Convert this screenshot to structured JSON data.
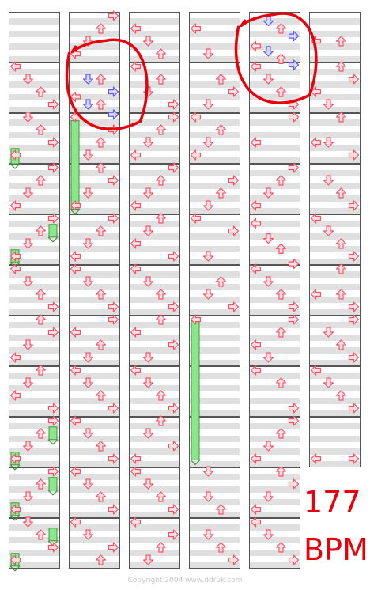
{
  "bpm": {
    "value": "177",
    "unit": "BPM"
  },
  "copyright": "Copyright 2004 www.ddruk.com",
  "colors": {
    "note": "#ff5064",
    "note_alt": "#5a5aff",
    "freeze": "#8ce68c",
    "annotation": "#e8000a"
  },
  "chart_layout": {
    "columns": 6,
    "lanes": [
      "left",
      "down",
      "up",
      "right"
    ],
    "measures_per_column": [
      11,
      11,
      11,
      11,
      11,
      9
    ]
  },
  "notes": [
    {
      "c": 0,
      "m": 1,
      "l": 0,
      "b": 0
    },
    {
      "c": 0,
      "m": 1,
      "l": 1,
      "b": 0.25
    },
    {
      "c": 0,
      "m": 1,
      "l": 2,
      "b": 0.5
    },
    {
      "c": 0,
      "m": 1,
      "l": 3,
      "b": 0.75
    },
    {
      "c": 0,
      "m": 2,
      "l": 1,
      "b": 0
    },
    {
      "c": 0,
      "m": 2,
      "l": 2,
      "b": 0.25
    },
    {
      "c": 0,
      "m": 2,
      "l": 3,
      "b": 0.5
    },
    {
      "c": 0,
      "m": 2,
      "l": 0,
      "b": 0.75
    },
    {
      "c": 0,
      "m": 3,
      "l": 3,
      "b": 0
    },
    {
      "c": 0,
      "m": 3,
      "l": 2,
      "b": 0.25
    },
    {
      "c": 0,
      "m": 3,
      "l": 1,
      "b": 0.5
    },
    {
      "c": 0,
      "m": 3,
      "l": 0,
      "b": 0.75
    },
    {
      "c": 0,
      "m": 4,
      "l": 3,
      "b": 0
    },
    {
      "c": 0,
      "m": 4,
      "l": 2,
      "b": 0.25
    },
    {
      "c": 0,
      "m": 4,
      "l": 1,
      "b": 0.5
    },
    {
      "c": 0,
      "m": 4,
      "l": 0,
      "b": 0.75
    },
    {
      "c": 0,
      "m": 5,
      "l": 0,
      "b": 0
    },
    {
      "c": 0,
      "m": 5,
      "l": 1,
      "b": 0.25
    },
    {
      "c": 0,
      "m": 5,
      "l": 2,
      "b": 0.5
    },
    {
      "c": 0,
      "m": 5,
      "l": 3,
      "b": 0.75
    },
    {
      "c": 0,
      "m": 6,
      "l": 2,
      "b": 0
    },
    {
      "c": 0,
      "m": 6,
      "l": 3,
      "b": 0.25
    },
    {
      "c": 0,
      "m": 6,
      "l": 1,
      "b": 0.5
    },
    {
      "c": 0,
      "m": 6,
      "l": 0,
      "b": 0.75
    },
    {
      "c": 0,
      "m": 7,
      "l": 2,
      "b": 0
    },
    {
      "c": 0,
      "m": 7,
      "l": 1,
      "b": 0.25
    },
    {
      "c": 0,
      "m": 7,
      "l": 0,
      "b": 0.5
    },
    {
      "c": 0,
      "m": 7,
      "l": 3,
      "b": 0.75
    },
    {
      "c": 0,
      "m": 8,
      "l": 3,
      "b": 0
    },
    {
      "c": 0,
      "m": 8,
      "l": 2,
      "b": 0.25
    },
    {
      "c": 0,
      "m": 8,
      "l": 1,
      "b": 0.5
    },
    {
      "c": 0,
      "m": 8,
      "l": 0,
      "b": 0.75
    },
    {
      "c": 0,
      "m": 9,
      "l": 3,
      "b": 0
    },
    {
      "c": 0,
      "m": 9,
      "l": 2,
      "b": 0.25
    },
    {
      "c": 0,
      "m": 9,
      "l": 1,
      "b": 0.5
    },
    {
      "c": 0,
      "m": 9,
      "l": 0,
      "b": 0.75
    },
    {
      "c": 0,
      "m": 10,
      "l": 1,
      "b": 0
    },
    {
      "c": 0,
      "m": 10,
      "l": 2,
      "b": 0.25
    },
    {
      "c": 0,
      "m": 10,
      "l": 3,
      "b": 0.5
    },
    {
      "c": 0,
      "m": 10,
      "l": 0,
      "b": 0.75
    },
    {
      "c": 1,
      "m": 0,
      "l": 3,
      "b": 0
    },
    {
      "c": 1,
      "m": 0,
      "l": 2,
      "b": 0.25
    },
    {
      "c": 1,
      "m": 0,
      "l": 1,
      "b": 0.5
    },
    {
      "c": 1,
      "m": 0,
      "l": 0,
      "b": 0.75
    },
    {
      "c": 1,
      "m": 1,
      "l": 1,
      "b": 0.25
    },
    {
      "c": 1,
      "m": 1,
      "l": 2,
      "b": 0.25
    },
    {
      "c": 1,
      "m": 1,
      "l": 3,
      "b": 0.5
    },
    {
      "c": 1,
      "m": 1,
      "l": 0,
      "b": 0.6
    },
    {
      "c": 1,
      "m": 1,
      "l": 1,
      "b": 0.75
    },
    {
      "c": 1,
      "m": 1,
      "l": 2,
      "b": 0.75
    },
    {
      "c": 1,
      "m": 1,
      "l": 3,
      "b": 0.95
    },
    {
      "c": 1,
      "m": 2,
      "l": 0,
      "b": 0
    },
    {
      "c": 1,
      "m": 2,
      "l": 3,
      "b": 0.25
    },
    {
      "c": 1,
      "m": 2,
      "l": 2,
      "b": 0.5
    },
    {
      "c": 1,
      "m": 2,
      "l": 1,
      "b": 0.75
    },
    {
      "c": 1,
      "m": 3,
      "l": 2,
      "b": 0
    },
    {
      "c": 1,
      "m": 3,
      "l": 3,
      "b": 0.25
    },
    {
      "c": 1,
      "m": 3,
      "l": 1,
      "b": 0.5
    },
    {
      "c": 1,
      "m": 3,
      "l": 0,
      "b": 0.75
    },
    {
      "c": 1,
      "m": 4,
      "l": 3,
      "b": 0
    },
    {
      "c": 1,
      "m": 4,
      "l": 2,
      "b": 0.25
    },
    {
      "c": 1,
      "m": 4,
      "l": 1,
      "b": 0.5
    },
    {
      "c": 1,
      "m": 4,
      "l": 0,
      "b": 0.75
    },
    {
      "c": 1,
      "m": 5,
      "l": 0,
      "b": 0
    },
    {
      "c": 1,
      "m": 5,
      "l": 1,
      "b": 0.25
    },
    {
      "c": 1,
      "m": 5,
      "l": 2,
      "b": 0.5
    },
    {
      "c": 1,
      "m": 5,
      "l": 3,
      "b": 0.75
    },
    {
      "c": 1,
      "m": 6,
      "l": 3,
      "b": 0
    },
    {
      "c": 1,
      "m": 6,
      "l": 0,
      "b": 0.25
    },
    {
      "c": 1,
      "m": 6,
      "l": 2,
      "b": 0.5
    },
    {
      "c": 1,
      "m": 6,
      "l": 1,
      "b": 0.75
    },
    {
      "c": 1,
      "m": 7,
      "l": 0,
      "b": 0
    },
    {
      "c": 1,
      "m": 7,
      "l": 1,
      "b": 0.25
    },
    {
      "c": 1,
      "m": 7,
      "l": 2,
      "b": 0.5
    },
    {
      "c": 1,
      "m": 7,
      "l": 3,
      "b": 0.75
    },
    {
      "c": 1,
      "m": 8,
      "l": 0,
      "b": 0
    },
    {
      "c": 1,
      "m": 8,
      "l": 1,
      "b": 0.25
    },
    {
      "c": 1,
      "m": 8,
      "l": 2,
      "b": 0.5
    },
    {
      "c": 1,
      "m": 8,
      "l": 3,
      "b": 0.75
    },
    {
      "c": 1,
      "m": 9,
      "l": 0,
      "b": 0
    },
    {
      "c": 1,
      "m": 9,
      "l": 1,
      "b": 0.25
    },
    {
      "c": 1,
      "m": 9,
      "l": 2,
      "b": 0.5
    },
    {
      "c": 1,
      "m": 9,
      "l": 3,
      "b": 0.75
    },
    {
      "c": 1,
      "m": 10,
      "l": 0,
      "b": 0
    },
    {
      "c": 1,
      "m": 10,
      "l": 1,
      "b": 0.25
    },
    {
      "c": 1,
      "m": 10,
      "l": 3,
      "b": 0.5
    },
    {
      "c": 1,
      "m": 10,
      "l": 2,
      "b": 0.75
    },
    {
      "c": 2,
      "m": 0,
      "l": 0,
      "b": 0.25
    },
    {
      "c": 2,
      "m": 0,
      "l": 1,
      "b": 0.5
    },
    {
      "c": 2,
      "m": 0,
      "l": 2,
      "b": 0.75
    },
    {
      "c": 2,
      "m": 1,
      "l": 0,
      "b": 0
    },
    {
      "c": 2,
      "m": 1,
      "l": 2,
      "b": 0.25
    },
    {
      "c": 2,
      "m": 1,
      "l": 1,
      "b": 0.5
    },
    {
      "c": 2,
      "m": 1,
      "l": 3,
      "b": 0.75
    },
    {
      "c": 2,
      "m": 2,
      "l": 3,
      "b": 0
    },
    {
      "c": 2,
      "m": 2,
      "l": 2,
      "b": 0.25
    },
    {
      "c": 2,
      "m": 2,
      "l": 1,
      "b": 0.5
    },
    {
      "c": 2,
      "m": 2,
      "l": 0,
      "b": 0.75
    },
    {
      "c": 2,
      "m": 3,
      "l": 3,
      "b": 0
    },
    {
      "c": 2,
      "m": 3,
      "l": 2,
      "b": 0.25
    },
    {
      "c": 2,
      "m": 3,
      "l": 1,
      "b": 0.5
    },
    {
      "c": 2,
      "m": 3,
      "l": 0,
      "b": 0.75
    },
    {
      "c": 2,
      "m": 4,
      "l": 2,
      "b": 0
    },
    {
      "c": 2,
      "m": 4,
      "l": 1,
      "b": 0.25
    },
    {
      "c": 2,
      "m": 4,
      "l": 0,
      "b": 0.5
    },
    {
      "c": 2,
      "m": 4,
      "l": 3,
      "b": 0.75
    },
    {
      "c": 2,
      "m": 5,
      "l": 0,
      "b": 0
    },
    {
      "c": 2,
      "m": 5,
      "l": 1,
      "b": 0.25
    },
    {
      "c": 2,
      "m": 5,
      "l": 2,
      "b": 0.5
    },
    {
      "c": 2,
      "m": 5,
      "l": 3,
      "b": 0.75
    },
    {
      "c": 2,
      "m": 6,
      "l": 2,
      "b": 0
    },
    {
      "c": 2,
      "m": 6,
      "l": 0,
      "b": 0.25
    },
    {
      "c": 2,
      "m": 6,
      "l": 3,
      "b": 0.5
    },
    {
      "c": 2,
      "m": 6,
      "l": 1,
      "b": 0.75
    },
    {
      "c": 2,
      "m": 7,
      "l": 0,
      "b": 0
    },
    {
      "c": 2,
      "m": 7,
      "l": 1,
      "b": 0.25
    },
    {
      "c": 2,
      "m": 7,
      "l": 2,
      "b": 0.5
    },
    {
      "c": 2,
      "m": 7,
      "l": 3,
      "b": 0.75
    },
    {
      "c": 2,
      "m": 8,
      "l": 2,
      "b": 0
    },
    {
      "c": 2,
      "m": 8,
      "l": 1,
      "b": 0.25
    },
    {
      "c": 2,
      "m": 8,
      "l": 3,
      "b": 0.5
    },
    {
      "c": 2,
      "m": 8,
      "l": 0,
      "b": 0.75
    },
    {
      "c": 2,
      "m": 9,
      "l": 0,
      "b": 0
    },
    {
      "c": 2,
      "m": 9,
      "l": 1,
      "b": 0.25
    },
    {
      "c": 2,
      "m": 9,
      "l": 2,
      "b": 0.5
    },
    {
      "c": 2,
      "m": 9,
      "l": 3,
      "b": 0.75
    },
    {
      "c": 2,
      "m": 10,
      "l": 0,
      "b": 0
    },
    {
      "c": 2,
      "m": 10,
      "l": 3,
      "b": 0.25
    },
    {
      "c": 2,
      "m": 10,
      "l": 2,
      "b": 0.5
    },
    {
      "c": 2,
      "m": 10,
      "l": 1,
      "b": 0.75
    },
    {
      "c": 3,
      "m": 0,
      "l": 0,
      "b": 0.25
    },
    {
      "c": 3,
      "m": 0,
      "l": 1,
      "b": 0.75
    },
    {
      "c": 3,
      "m": 1,
      "l": 2,
      "b": 0.25
    },
    {
      "c": 3,
      "m": 1,
      "l": 3,
      "b": 0.5
    },
    {
      "c": 3,
      "m": 1,
      "l": 1,
      "b": 0.75
    },
    {
      "c": 3,
      "m": 2,
      "l": 0,
      "b": 0
    },
    {
      "c": 3,
      "m": 2,
      "l": 2,
      "b": 0.25
    },
    {
      "c": 3,
      "m": 2,
      "l": 1,
      "b": 0.5
    },
    {
      "c": 3,
      "m": 2,
      "l": 0,
      "b": 0.75
    },
    {
      "c": 3,
      "m": 3,
      "l": 3,
      "b": 0.25
    },
    {
      "c": 3,
      "m": 3,
      "l": 2,
      "b": 0.5
    },
    {
      "c": 3,
      "m": 3,
      "l": 1,
      "b": 0.75
    },
    {
      "c": 3,
      "m": 4,
      "l": 0,
      "b": 0
    },
    {
      "c": 3,
      "m": 4,
      "l": 3,
      "b": 0.25
    },
    {
      "c": 3,
      "m": 4,
      "l": 1,
      "b": 0.75
    },
    {
      "c": 3,
      "m": 5,
      "l": 2,
      "b": 0.25
    },
    {
      "c": 3,
      "m": 5,
      "l": 1,
      "b": 0.5
    },
    {
      "c": 3,
      "m": 5,
      "l": 3,
      "b": 0.75
    },
    {
      "c": 3,
      "m": 6,
      "l": 0,
      "b": 0
    },
    {
      "c": 3,
      "m": 9,
      "l": 1,
      "b": 0
    },
    {
      "c": 3,
      "m": 9,
      "l": 1,
      "b": 0.5
    },
    {
      "c": 3,
      "m": 9,
      "l": 2,
      "b": 0.75
    },
    {
      "c": 3,
      "m": 10,
      "l": 1,
      "b": 0.25
    },
    {
      "c": 3,
      "m": 10,
      "l": 2,
      "b": 0.5
    },
    {
      "c": 3,
      "m": 10,
      "l": 3,
      "b": 0.75
    },
    {
      "c": 4,
      "m": 0,
      "l": 1,
      "b": 0.1
    },
    {
      "c": 4,
      "m": 0,
      "l": 2,
      "b": 0.25
    },
    {
      "c": 4,
      "m": 0,
      "l": 3,
      "b": 0.4
    },
    {
      "c": 4,
      "m": 0,
      "l": 0,
      "b": 0.6
    },
    {
      "c": 4,
      "m": 0,
      "l": 1,
      "b": 0.7
    },
    {
      "c": 4,
      "m": 0,
      "l": 2,
      "b": 0.85
    },
    {
      "c": 4,
      "m": 0,
      "l": 3,
      "b": 0.97
    },
    {
      "c": 4,
      "m": 1,
      "l": 0,
      "b": 0
    },
    {
      "c": 4,
      "m": 1,
      "l": 1,
      "b": 0.25
    },
    {
      "c": 4,
      "m": 1,
      "l": 2,
      "b": 0.5
    },
    {
      "c": 4,
      "m": 1,
      "l": 3,
      "b": 0.75
    },
    {
      "c": 4,
      "m": 2,
      "l": 3,
      "b": 0
    },
    {
      "c": 4,
      "m": 2,
      "l": 0,
      "b": 0.5
    },
    {
      "c": 4,
      "m": 3,
      "l": 3,
      "b": 0
    },
    {
      "c": 4,
      "m": 3,
      "l": 2,
      "b": 0.25
    },
    {
      "c": 4,
      "m": 3,
      "l": 1,
      "b": 0.5
    },
    {
      "c": 4,
      "m": 3,
      "l": 0,
      "b": 0.75
    },
    {
      "c": 4,
      "m": 4,
      "l": 0,
      "b": 0.1
    },
    {
      "c": 4,
      "m": 4,
      "l": 1,
      "b": 0.4
    },
    {
      "c": 4,
      "m": 4,
      "l": 2,
      "b": 0.6
    },
    {
      "c": 4,
      "m": 4,
      "l": 3,
      "b": 0.9
    },
    {
      "c": 4,
      "m": 5,
      "l": 0,
      "b": 0
    },
    {
      "c": 4,
      "m": 5,
      "l": 1,
      "b": 0.25
    },
    {
      "c": 4,
      "m": 5,
      "l": 2,
      "b": 0.5
    },
    {
      "c": 4,
      "m": 5,
      "l": 3,
      "b": 0.75
    },
    {
      "c": 4,
      "m": 6,
      "l": 3,
      "b": 0
    },
    {
      "c": 4,
      "m": 6,
      "l": 2,
      "b": 0.25
    },
    {
      "c": 4,
      "m": 6,
      "l": 0,
      "b": 0.5
    },
    {
      "c": 4,
      "m": 6,
      "l": 1,
      "b": 0.75
    },
    {
      "c": 4,
      "m": 7,
      "l": 0,
      "b": 0
    },
    {
      "c": 4,
      "m": 7,
      "l": 2,
      "b": 0.25
    },
    {
      "c": 4,
      "m": 7,
      "l": 3,
      "b": 0.75
    },
    {
      "c": 4,
      "m": 8,
      "l": 3,
      "b": 0
    },
    {
      "c": 4,
      "m": 8,
      "l": 2,
      "b": 0.25
    },
    {
      "c": 4,
      "m": 8,
      "l": 1,
      "b": 0.5
    },
    {
      "c": 4,
      "m": 8,
      "l": 0,
      "b": 0.75
    },
    {
      "c": 4,
      "m": 9,
      "l": 2,
      "b": 0
    },
    {
      "c": 4,
      "m": 9,
      "l": 3,
      "b": 0.25
    },
    {
      "c": 4,
      "m": 9,
      "l": 1,
      "b": 0.5
    },
    {
      "c": 4,
      "m": 9,
      "l": 0,
      "b": 0.75
    },
    {
      "c": 4,
      "m": 10,
      "l": 0,
      "b": 0
    },
    {
      "c": 4,
      "m": 10,
      "l": 1,
      "b": 0.25
    },
    {
      "c": 4,
      "m": 10,
      "l": 2,
      "b": 0.5
    },
    {
      "c": 4,
      "m": 10,
      "l": 3,
      "b": 0.75
    },
    {
      "c": 5,
      "m": 0,
      "l": 0,
      "b": 0.5
    },
    {
      "c": 5,
      "m": 0,
      "l": 2,
      "b": 0.5
    },
    {
      "c": 5,
      "m": 1,
      "l": 2,
      "b": 0
    },
    {
      "c": 5,
      "m": 1,
      "l": 3,
      "b": 0.25
    },
    {
      "c": 5,
      "m": 1,
      "l": 0,
      "b": 0.5
    },
    {
      "c": 5,
      "m": 1,
      "l": 1,
      "b": 0.75
    },
    {
      "c": 5,
      "m": 2,
      "l": 2,
      "b": 0
    },
    {
      "c": 5,
      "m": 2,
      "l": 0,
      "b": 0.5
    },
    {
      "c": 5,
      "m": 2,
      "l": 1,
      "b": 0.5
    },
    {
      "c": 5,
      "m": 2,
      "l": 3,
      "b": 0.75
    },
    {
      "c": 5,
      "m": 3,
      "l": 1,
      "b": 0.25
    },
    {
      "c": 5,
      "m": 3,
      "l": 2,
      "b": 0.5
    },
    {
      "c": 5,
      "m": 3,
      "l": 3,
      "b": 0.75
    },
    {
      "c": 5,
      "m": 4,
      "l": 0,
      "b": 0
    },
    {
      "c": 5,
      "m": 4,
      "l": 1,
      "b": 0.25
    },
    {
      "c": 5,
      "m": 4,
      "l": 2,
      "b": 0.5
    },
    {
      "c": 5,
      "m": 4,
      "l": 3,
      "b": 0.75
    },
    {
      "c": 5,
      "m": 5,
      "l": 2,
      "b": 0
    },
    {
      "c": 5,
      "m": 5,
      "l": 0,
      "b": 0.5
    },
    {
      "c": 5,
      "m": 5,
      "l": 2,
      "b": 0.5
    },
    {
      "c": 5,
      "m": 5,
      "l": 3,
      "b": 0.75
    },
    {
      "c": 5,
      "m": 6,
      "l": 3,
      "b": 0
    },
    {
      "c": 5,
      "m": 6,
      "l": 1,
      "b": 0.25
    },
    {
      "c": 5,
      "m": 6,
      "l": 2,
      "b": 0.5
    },
    {
      "c": 5,
      "m": 6,
      "l": 3,
      "b": 0.75
    },
    {
      "c": 5,
      "m": 7,
      "l": 0,
      "b": 0
    },
    {
      "c": 5,
      "m": 7,
      "l": 1,
      "b": 0.25
    },
    {
      "c": 5,
      "m": 7,
      "l": 2,
      "b": 0.5
    },
    {
      "c": 5,
      "m": 7,
      "l": 3,
      "b": 0.75
    },
    {
      "c": 5,
      "m": 8,
      "l": 0,
      "b": 0.75
    },
    {
      "c": 5,
      "m": 8,
      "l": 3,
      "b": 0.75
    }
  ],
  "alt_notes": [
    {
      "c": 1,
      "m": 1,
      "l": 1,
      "b": 0.25
    },
    {
      "c": 1,
      "m": 1,
      "l": 3,
      "b": 0.5
    },
    {
      "c": 1,
      "m": 1,
      "l": 1,
      "b": 0.75
    },
    {
      "c": 1,
      "m": 1,
      "l": 3,
      "b": 0.95
    },
    {
      "c": 4,
      "m": 0,
      "l": 1,
      "b": 0.1
    },
    {
      "c": 4,
      "m": 0,
      "l": 3,
      "b": 0.4
    },
    {
      "c": 4,
      "m": 0,
      "l": 1,
      "b": 0.7
    },
    {
      "c": 4,
      "m": 0,
      "l": 3,
      "b": 0.97
    }
  ],
  "freezes": [
    {
      "c": 0,
      "l": 0,
      "s": 2.7,
      "e": 3.0
    },
    {
      "c": 0,
      "l": 3,
      "s": 4.2,
      "e": 4.45
    },
    {
      "c": 0,
      "l": 0,
      "s": 4.7,
      "e": 4.95
    },
    {
      "c": 0,
      "l": 3,
      "s": 8.2,
      "e": 8.45
    },
    {
      "c": 0,
      "l": 0,
      "s": 8.7,
      "e": 8.95
    },
    {
      "c": 0,
      "l": 3,
      "s": 9.2,
      "e": 9.45
    },
    {
      "c": 0,
      "l": 0,
      "s": 9.7,
      "e": 9.95
    },
    {
      "c": 0,
      "l": 3,
      "s": 10.2,
      "e": 10.45
    },
    {
      "c": 0,
      "l": 0,
      "s": 10.7,
      "e": 10.95
    },
    {
      "c": 1,
      "l": 0,
      "s": 2.15,
      "e": 3.9
    },
    {
      "c": 3,
      "l": 0,
      "s": 6.1,
      "e": 8.85
    }
  ],
  "annotations": [
    {
      "c": 1,
      "m": 0.6,
      "shape": "circle"
    },
    {
      "c": 4,
      "m": -0.2,
      "shape": "circle"
    }
  ]
}
